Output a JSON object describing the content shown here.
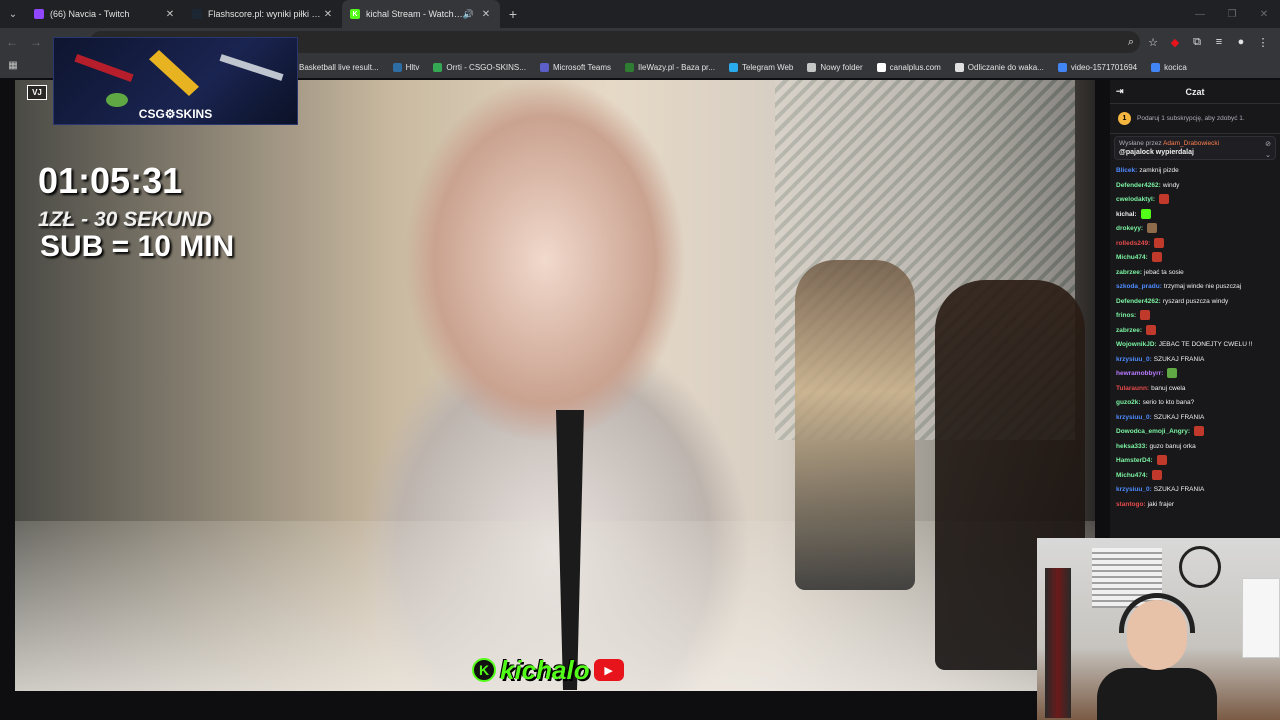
{
  "tabs": [
    {
      "title": "(66) Navcia - Twitch",
      "favicon_color": "#9146ff",
      "favicon_letter": "",
      "active": false
    },
    {
      "title": "Flashscore.pl: wyniki piłki nożnej",
      "favicon_color": "#1c2733",
      "favicon_letter": "",
      "active": false
    },
    {
      "title": "kichal Stream - Watch Live on Kick",
      "favicon_color": "#53fc18",
      "favicon_letter": "K",
      "active": true
    }
  ],
  "toolbar": {
    "back_icon": "←",
    "forward_icon": "→",
    "reload_icon": "↻"
  },
  "bookmarks": [
    {
      "label": "Basketball live result...",
      "color": "#7b68ee"
    },
    {
      "label": "Hltv",
      "color": "#2d6da3"
    },
    {
      "label": "Orrti - CSGO-SKINS...",
      "color": "#34a853"
    },
    {
      "label": "Microsoft Teams",
      "color": "#5b5fc7"
    },
    {
      "label": "IleWazy.pl - Baza pr...",
      "color": "#2e7d32"
    },
    {
      "label": "Telegram Web",
      "color": "#2aabee"
    },
    {
      "label": "Nowy folder",
      "color": "#c4c7c5"
    },
    {
      "label": "canalplus.com",
      "color": "#ffffff"
    },
    {
      "label": "Odliczanie do waka...",
      "color": "#e0e0e0"
    },
    {
      "label": "video-1571701694",
      "color": "#4285f4"
    },
    {
      "label": "kocica",
      "color": "#4285f4"
    }
  ],
  "overlay": {
    "ad_logo": "CSG⚙SKINS",
    "badge": "VJ",
    "timer": "01:05:31",
    "rule_donation": "1ZŁ - 30 SEKUND",
    "rule_sub": "SUB = 10 MIN",
    "brand_text": "kichalo",
    "brand_k": "K"
  },
  "chat": {
    "title": "Czat",
    "sub_banner": "Podaruj 1 subskrypcję, aby zdobyć 1.",
    "pinned": {
      "sent_by": "Wysłane przez",
      "sender": "Adam_Drabowiecki",
      "text": "@pajalock wypierdalaj"
    },
    "messages": [
      {
        "user": "Blicek:",
        "user_color": "#4e8cff",
        "text": "zamknij pizde",
        "emote": ""
      },
      {
        "user": "Defender4262:",
        "user_color": "#7bf3a1",
        "text": "windy",
        "emote": ""
      },
      {
        "user": "cwelodaktyl:",
        "user_color": "#7bf3a1",
        "text": "",
        "emote": "#c0392b"
      },
      {
        "user": "kichal:",
        "user_color": "#efeff1",
        "text": "",
        "emote": "#53fc18"
      },
      {
        "user": "drokeyy:",
        "user_color": "#7bf3a1",
        "text": "",
        "emote": "#8e6b4a"
      },
      {
        "user": "rolleds249:",
        "user_color": "#e64a4a",
        "text": "",
        "emote": "#c0392b"
      },
      {
        "user": "Michu474:",
        "user_color": "#7bf3a1",
        "text": "",
        "emote": "#c0392b"
      },
      {
        "user": "zabrzee:",
        "user_color": "#7bf3a1",
        "text": "jebać ta sosie",
        "emote": ""
      },
      {
        "user": "szkoda_pradu:",
        "user_color": "#4e8cff",
        "text": "trzymaj winde nie puszczaj",
        "emote": ""
      },
      {
        "user": "Defender4262:",
        "user_color": "#7bf3a1",
        "text": "ryszard puszcza windy",
        "emote": ""
      },
      {
        "user": "frinos:",
        "user_color": "#7bf3a1",
        "text": "",
        "emote": "#c0392b"
      },
      {
        "user": "zabrzee:",
        "user_color": "#7bf3a1",
        "text": "",
        "emote": "#c0392b"
      },
      {
        "user": "WojownikJD:",
        "user_color": "#7bf3a1",
        "text": "JEBAC TE DONEJTY CWELU !!",
        "emote": ""
      },
      {
        "user": "krzysiuu_0:",
        "user_color": "#4e8cff",
        "text": "SZUKAJ FRANIA",
        "emote": ""
      },
      {
        "user": "hewramobbyrr:",
        "user_color": "#b97cff",
        "text": "",
        "emote": "#5fa843"
      },
      {
        "user": "Tularaunn:",
        "user_color": "#e64a4a",
        "text": "banuj cwela",
        "emote": ""
      },
      {
        "user": "guzo2k:",
        "user_color": "#7bf3a1",
        "text": "serio to kto bana?",
        "emote": ""
      },
      {
        "user": "krzysiuu_0:",
        "user_color": "#4e8cff",
        "text": "SZUKAJ FRANIA",
        "emote": ""
      },
      {
        "user": "Dowodca_emoji_Angry:",
        "user_color": "#7bf3a1",
        "text": "",
        "emote": "#c0392b"
      },
      {
        "user": "heksa333:",
        "user_color": "#7bf3a1",
        "text": "guzo banuj orka",
        "emote": ""
      },
      {
        "user": "HamsterD4:",
        "user_color": "#7bf3a1",
        "text": "",
        "emote": "#c0392b"
      },
      {
        "user": "Michu474:",
        "user_color": "#7bf3a1",
        "text": "",
        "emote": "#c0392b"
      },
      {
        "user": "krzysiuu_0:",
        "user_color": "#4e8cff",
        "text": "SZUKAJ FRANIA",
        "emote": ""
      },
      {
        "user": "stantogo:",
        "user_color": "#e64a4a",
        "text": "jaki frajer",
        "emote": ""
      }
    ]
  }
}
